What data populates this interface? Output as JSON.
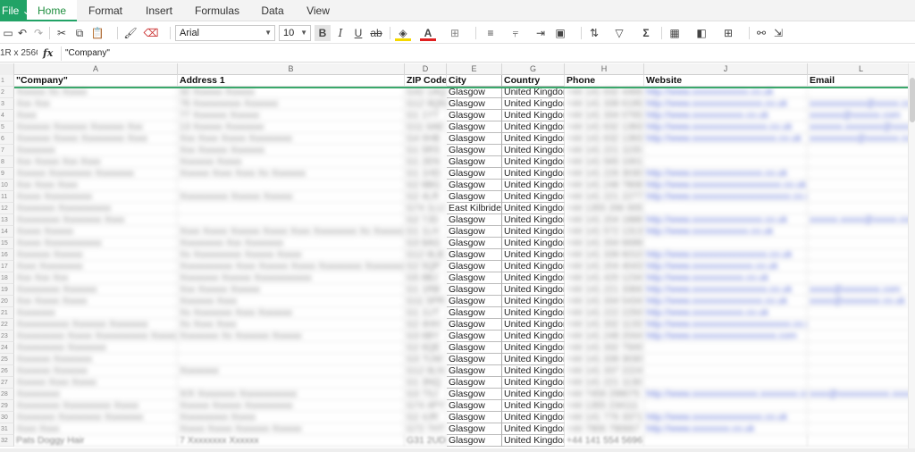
{
  "menu": {
    "file_label": "File ⌄",
    "tabs": [
      "Home",
      "Format",
      "Insert",
      "Formulas",
      "Data",
      "View"
    ]
  },
  "toolbar": {
    "font_name": "Arial",
    "font_size": "10",
    "bold": "B",
    "italic": "I",
    "underline": "U",
    "strike": "ab",
    "sum": "Σ"
  },
  "formula_bar": {
    "name_box": "1R x 256C",
    "fx": "fx",
    "value": "\"Company\""
  },
  "columns": [
    "A",
    "B",
    "D",
    "E",
    "G",
    "H",
    "J",
    "L"
  ],
  "header_row": {
    "company": "\"Company\"",
    "address": "Address 1",
    "zip": "ZIP Code",
    "city": "City",
    "country": "Country",
    "phone": "Phone",
    "website": "Website",
    "email": "Email"
  },
  "rows": [
    {
      "n": "2",
      "company": "Xxxxxx Xx Xxxxx",
      "address": "32 Xxxxxx Xxxxxx",
      "zip": "G42 1AQ",
      "city": "Glasgow",
      "country": "United Kingdom",
      "phone": "+44 141 632 4466",
      "website": "http://www.xxxxxxxxxxxx.co.uk",
      "email": ""
    },
    {
      "n": "3",
      "company": "Xxx Xxx",
      "address": "76 Xxxxxxxxxx Xxxxxxx",
      "zip": "G12 9QN",
      "city": "Glasgow",
      "country": "United Kingdom",
      "phone": "+44 141 339 6195",
      "website": "http://www.xxxxxxxxxxxxxxx.co.uk",
      "email": "xxxxxxxxxxxx@xxxxx.co.uk"
    },
    {
      "n": "4",
      "company": "Xxxx",
      "address": "77 Xxxxxxx Xxxxxx",
      "zip": "G1 1YT",
      "city": "Glasgow",
      "country": "United Kingdom",
      "phone": "+44 141 334 0765",
      "website": "http://www.xxxxxxxxxxx.co.uk",
      "email": "xxxxxxx@xxxxxx.com"
    },
    {
      "n": "5",
      "company": "Xxxxxxx Xxxxxxx Xxxxxxx Xxx",
      "address": "13 Xxxxxx Xxxxxxxx",
      "zip": "G11 6AE",
      "city": "Glasgow",
      "country": "United Kingdom",
      "phone": "+44 141 632 1393",
      "website": "http://www.xxxxxxxxxxxxxxxx.co.uk",
      "email": "xxxxxxx.xxxxxxxx@xxxx.com"
    },
    {
      "n": "6",
      "company": "Xxxxxxx Xxxxx Xxxxxxxxx Xxxx",
      "address": "Xxx Xxxx Xxxxx Xxxxxxxxx",
      "zip": "G4 0HB",
      "city": "Glasgow",
      "country": "United Kingdom",
      "phone": "+44 141 632 1393",
      "website": "http://www.xxxxxxxxxxxxxxxxxx.co.uk",
      "email": "xxxxxxxxxx@xxxxxxx.com"
    },
    {
      "n": "7",
      "company": "Xxxxxxxx",
      "address": "Xxx Xxxxxx Xxxxxxx",
      "zip": "G1 5RS",
      "city": "Glasgow",
      "country": "United Kingdom",
      "phone": "+44 141 221 1155",
      "website": "",
      "email": ""
    },
    {
      "n": "8",
      "company": "Xxx Xxxxx Xxx Xxxx",
      "address": "Xxxxxxx Xxxxx",
      "zip": "G1 2EN",
      "city": "Glasgow",
      "country": "United Kingdom",
      "phone": "+44 141 565 1001",
      "website": "",
      "email": ""
    },
    {
      "n": "9",
      "company": "Xxxxxx Xxxxxxxxx Xxxxxxxx",
      "address": "Xxxxxx Xxxx Xxxx Xx Xxxxxxx",
      "zip": "G1 1HD",
      "city": "Glasgow",
      "country": "United Kingdom",
      "phone": "+44 141 226 3030",
      "website": "http://www.xxxxxxxxxxxxxxx.co.uk",
      "email": ""
    },
    {
      "n": "10",
      "company": "Xxx Xxxx Xxxx",
      "address": "",
      "zip": "G2 8BG",
      "city": "Glasgow",
      "country": "United Kingdom",
      "phone": "+44 141 248 7808",
      "website": "http://www.xxxxxxxxxxxxxxxxxxx.co.uk",
      "email": ""
    },
    {
      "n": "11",
      "company": "Xxxxx Xxxxxxxxxx",
      "address": "Xxxxxxxxxx Xxxxxx Xxxxxx",
      "zip": "G2 4LR",
      "city": "Glasgow",
      "country": "United Kingdom",
      "phone": "+44 141 221 2277",
      "website": "http://www.xxxxxxxxxxxxxxxxxxxxx.co.uk",
      "email": ""
    },
    {
      "n": "12",
      "company": "Xxxxxxxx Xxxxxxxxxxx",
      "address": "",
      "zip": "G74 1LU",
      "city": "East Kilbride",
      "country": "United Kingdom",
      "phone": "+44 1355 266 005",
      "website": "",
      "email": ""
    },
    {
      "n": "13",
      "company": "Xxxxxxxxx Xxxxxxxx Xxxx",
      "address": "",
      "zip": "G2 7JD",
      "city": "Glasgow",
      "country": "United Kingdom",
      "phone": "+44 141 204 1888",
      "website": "http://www.xxxxxxxxxxxxxxx.co.uk",
      "email": "xxxxxx.xxxxx@xxxxx.com"
    },
    {
      "n": "14",
      "company": "Xxxxx Xxxxxx",
      "address": "Xxxx Xxxxx Xxxxxx Xxxxx Xxxx Xxxxxxxxx Xx Xxxxxxx",
      "zip": "G1 1LH",
      "city": "Glasgow",
      "country": "United Kingdom",
      "phone": "+44 141 572 1313",
      "website": "http://www.xxxxxxxxxxxx.co.uk",
      "email": ""
    },
    {
      "n": "15",
      "company": "Xxxxx Xxxxxxxxxxxx",
      "address": "Xxxxxxxxx Xxx Xxxxxxxx",
      "zip": "G3 8AG",
      "city": "Glasgow",
      "country": "United Kingdom",
      "phone": "+44 141 334 6699",
      "website": "",
      "email": ""
    },
    {
      "n": "16",
      "company": "Xxxxxxx Xxxxxx",
      "address": "Xx Xxxxxxxxxx Xxxxxx Xxxxx",
      "zip": "G12 8LB",
      "city": "Glasgow",
      "country": "United Kingdom",
      "phone": "+44 141 339 6010",
      "website": "http://www.xxxxxxxxxxxxxxxx.co.uk",
      "email": ""
    },
    {
      "n": "17",
      "company": "Xxxx Xxxxxxxxx",
      "address": "Xxxxxxxxxxx Xxxx Xxxxxx Xxxxx Xxxxxxxxx Xxxxxxxx",
      "zip": "G2 5QP",
      "city": "Glasgow",
      "country": "United Kingdom",
      "phone": "+44 141 204 4043",
      "website": "http://www.xxxxxxxxxxxxx.co.uk",
      "email": ""
    },
    {
      "n": "18",
      "company": "Xxx Xxx Xxx",
      "address": "Xxxxxxxx Xxxxxx Xxxxxxxxxxxx",
      "zip": "G5 8BJ",
      "city": "Glasgow",
      "country": "United Kingdom",
      "phone": "+44 141 420 1234",
      "website": "http://www.xxxxxxxxxxx.co.uk",
      "email": ""
    },
    {
      "n": "19",
      "company": "Xxxxxxxxx Xxxxxxx",
      "address": "Xxx Xxxxxx Xxxxxx",
      "zip": "G1 1RB",
      "city": "Glasgow",
      "country": "United Kingdom",
      "phone": "+44 141 221 3366",
      "website": "http://www.xxxxxxxxxxxxxxxx.co.uk",
      "email": "xxxxx@xxxxxxxx.com"
    },
    {
      "n": "20",
      "company": "Xxx Xxxxx Xxxxx",
      "address": "Xxxxxxx Xxxx",
      "zip": "G11 5PR",
      "city": "Glasgow",
      "country": "United Kingdom",
      "phone": "+44 141 334 5434",
      "website": "http://www.xxxxxxxxxxxxxxx.co.uk",
      "email": "xxxxx@xxxxxxxx.co.uk"
    },
    {
      "n": "21",
      "company": "Xxxxxxxx",
      "address": "Xx Xxxxxxxx Xxxx Xxxxxxx",
      "zip": "G1 1UT",
      "city": "Glasgow",
      "country": "United Kingdom",
      "phone": "+44 141 222 2250",
      "website": "http://www.xxxxxxxxxxx.co.uk",
      "email": ""
    },
    {
      "n": "22",
      "company": "Xxxxxxxxxxx Xxxxxxx Xxxxxxxx",
      "address": "Xx Xxxx Xxxx",
      "zip": "G2 4HH",
      "city": "Glasgow",
      "country": "United Kingdom",
      "phone": "+44 141 332 1133",
      "website": "http://www.xxxxxxxxxxxxxxxxxxxxx.co.uk",
      "email": ""
    },
    {
      "n": "23",
      "company": "Xxxxxxxxxx Xxxxx Xxxxxxxxxxx Xxxxxx",
      "address": "Xxxxxxxx Xx Xxxxxxx Xxxxxx",
      "zip": "G3 6BY",
      "city": "Glasgow",
      "country": "United Kingdom",
      "phone": "+44 141 248 2044",
      "website": "http://www.xxxxxxxxxxxxxxxxxx.com",
      "email": ""
    },
    {
      "n": "24",
      "company": "Xxxxxxxxxx Xxxxxxxx",
      "address": "",
      "zip": "G2 6QE",
      "city": "Glasgow",
      "country": "United Kingdom",
      "phone": "+44 141 332 7500",
      "website": "",
      "email": ""
    },
    {
      "n": "25",
      "company": "Xxxxxxx Xxxxxxxx",
      "address": "",
      "zip": "G3 7UW",
      "city": "Glasgow",
      "country": "United Kingdom",
      "phone": "+44 141 339 3030",
      "website": "",
      "email": ""
    },
    {
      "n": "26",
      "company": "Xxxxxxx Xxxxxxx",
      "address": "Xxxxxxxx",
      "zip": "G12 8LN",
      "city": "Glasgow",
      "country": "United Kingdom",
      "phone": "+44 141 337 2224",
      "website": "",
      "email": ""
    },
    {
      "n": "27",
      "company": "Xxxxxx Xxxx Xxxxx",
      "address": "",
      "zip": "G1 3NQ",
      "city": "Glasgow",
      "country": "United Kingdom",
      "phone": "+44 141 221 1130",
      "website": "",
      "email": ""
    },
    {
      "n": "28",
      "company": "Xxxxxxxxx",
      "address": "X/X Xxxxxxxx Xxxxxxxxxxxx",
      "zip": "G3 7SJ",
      "city": "Glasgow",
      "country": "United Kingdom",
      "phone": "+44 7459 299075",
      "website": "http://www.xxxxxxxxxxxxxx.xxxxxxxx.com",
      "email": "xxxx@xxxxxxxxxxx.xxxxxxx"
    },
    {
      "n": "29",
      "company": "Xxxxxxxxx Xxxxxxxxxx Xxxxx",
      "address": "Xxxxxx Xxxxxx Xxxxxxxxxx",
      "zip": "G74 4PY",
      "city": "Glasgow",
      "country": "United Kingdom",
      "phone": "+44 1355 234111",
      "website": "",
      "email": ""
    },
    {
      "n": "30",
      "company": "Xxxxxxxx Xxxxxxxxx Xxxxxxxx",
      "address": "Xxxxxxxxxx Xxxxx",
      "zip": "G2 4JR",
      "city": "Glasgow",
      "country": "United Kingdom",
      "phone": "+44 141 776 3371",
      "website": "http://www.xxxxxxxxxxxxxxx.co.uk",
      "email": ""
    },
    {
      "n": "31",
      "company": "Xxxx Xxxx",
      "address": "Xxxxx Xxxxx Xxxxxxx Xxxxxx",
      "zip": "G72 7HT",
      "city": "Glasgow",
      "country": "United Kingdom",
      "phone": "+44 7906 790667",
      "website": "http://www.xxxxxxxx.co.uk",
      "email": ""
    },
    {
      "n": "32",
      "company": "Pats Doggy Hair",
      "address": "7 Xxxxxxxx Xxxxxx",
      "zip": "G31 2UD",
      "city": "Glasgow",
      "country": "United Kingdom",
      "phone": "+44 141 554 5696",
      "website": "",
      "email": ""
    }
  ]
}
